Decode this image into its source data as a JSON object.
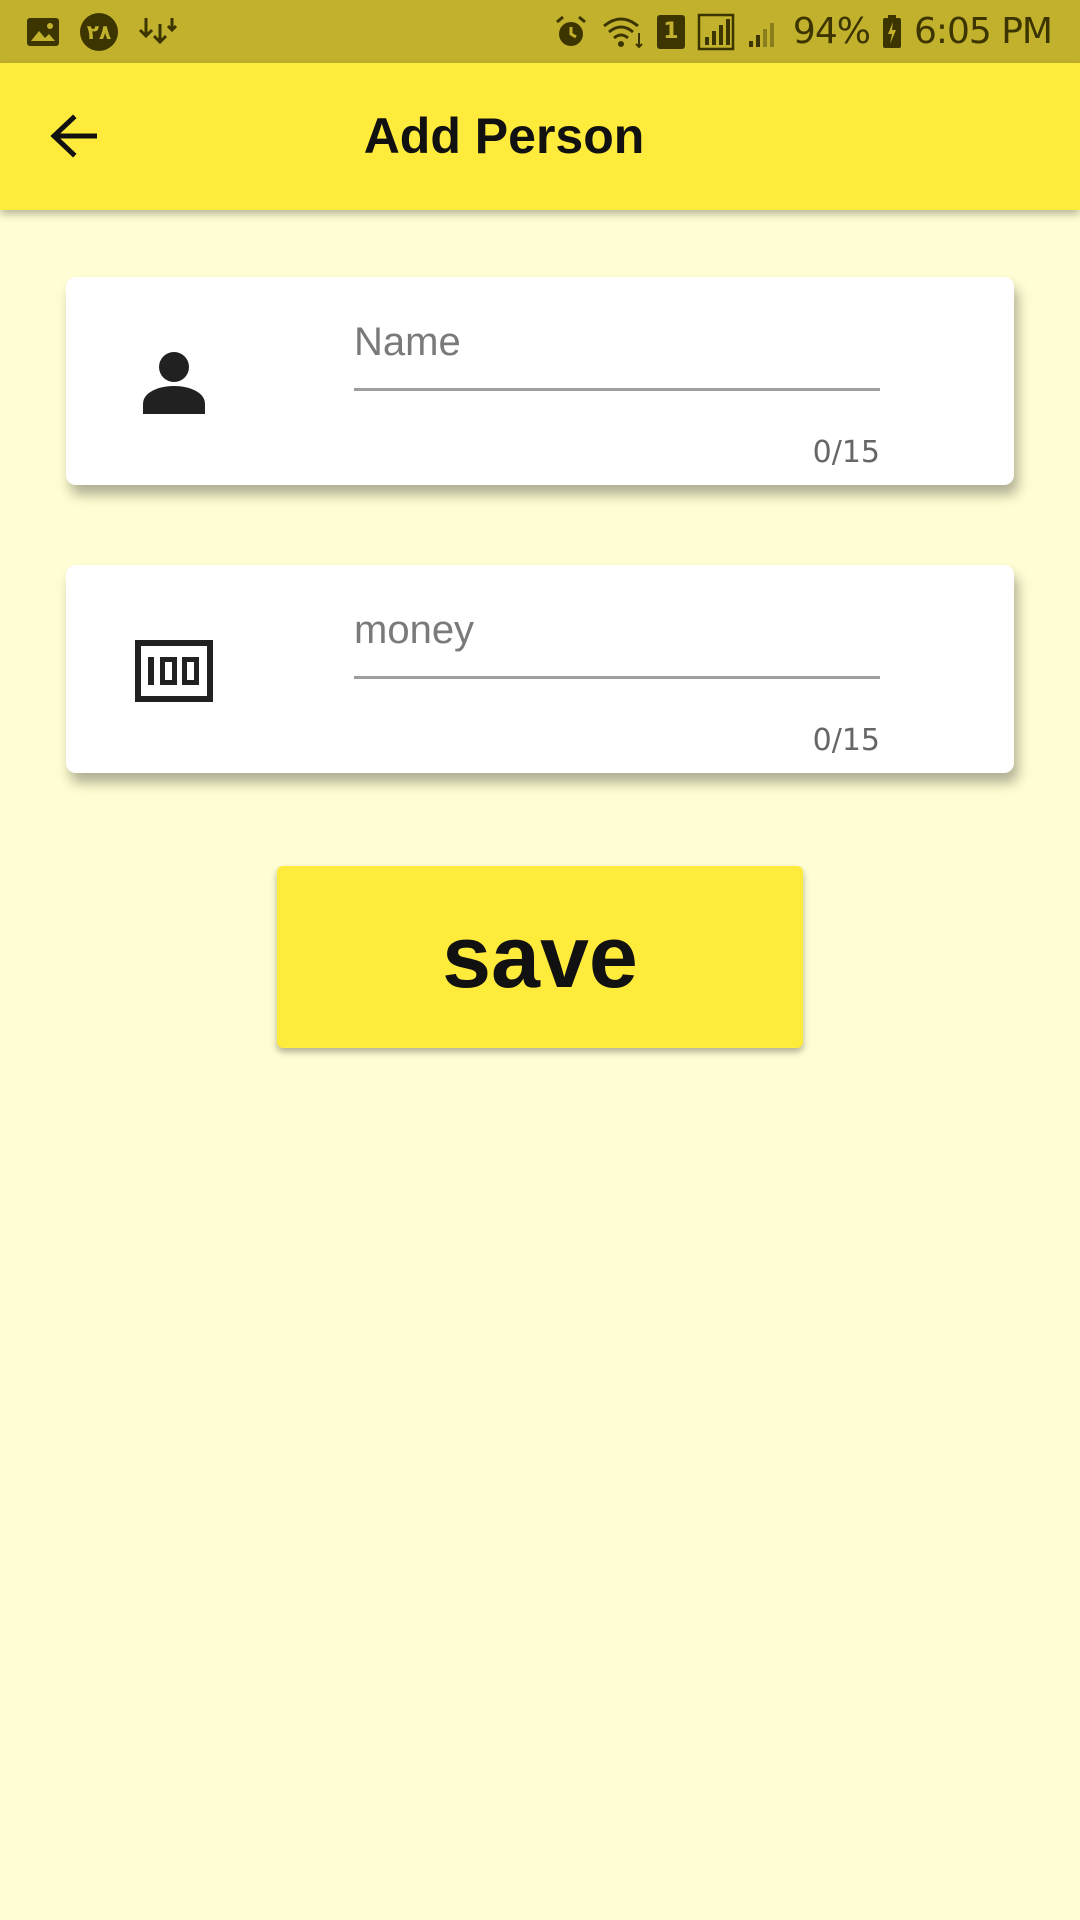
{
  "status_bar": {
    "left_icons": [
      "image-icon",
      "notification-badge-icon",
      "download-icon"
    ],
    "badge_text": "۲۸",
    "sim_slot": "1",
    "battery": "94%",
    "time": "6:05 PM",
    "right_icons": [
      "alarm-icon",
      "wifi-icon",
      "sim-icon",
      "signal-icon",
      "signal-weak-icon",
      "battery-charging-icon"
    ]
  },
  "app_bar": {
    "title": "Add Person",
    "back_icon": "arrow-back-icon",
    "background_color": "#ffeb3b"
  },
  "form": {
    "name_field": {
      "icon": "person-icon",
      "placeholder": "Name",
      "value": "",
      "counter": "0/15"
    },
    "money_field": {
      "icon": "money-icon",
      "placeholder": "money",
      "value": "",
      "counter": "0/15"
    }
  },
  "actions": {
    "save_label": "save"
  },
  "colors": {
    "status_bar": "#c2b12c",
    "accent": "#ffeb3b",
    "page_background": "#fefdd3",
    "card": "#ffffff"
  }
}
